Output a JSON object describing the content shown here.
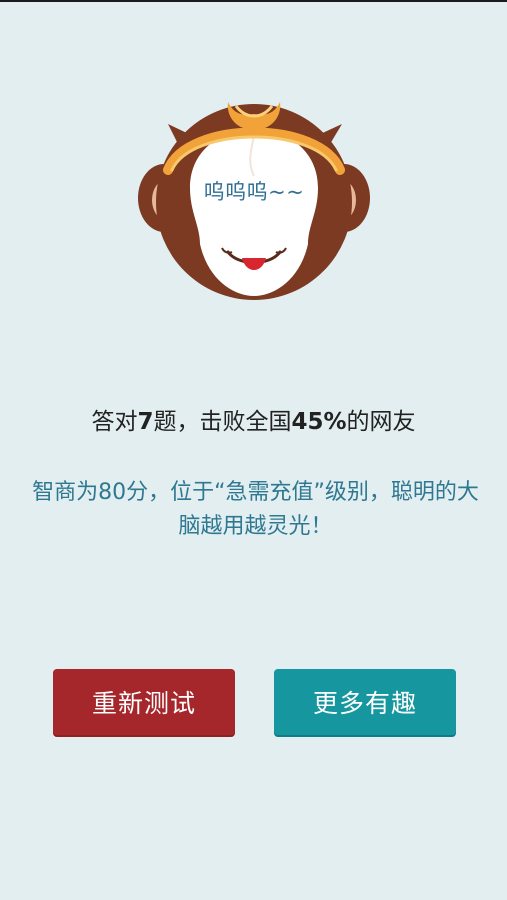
{
  "mascot": {
    "speech": "呜呜呜~~",
    "icon": "monkey-face-icon"
  },
  "result": {
    "prefix": "答对",
    "correct_count": "7",
    "middle": "题，击败全国",
    "percent": "45%",
    "suffix": "的网友"
  },
  "description": "智商为80分，位于“急需充值”级别，聪明的大脑越用越灵光！",
  "buttons": {
    "retry_label": "重新测试",
    "more_label": "更多有趣"
  },
  "colors": {
    "background": "#e2eef0",
    "retry_button": "#a5272b",
    "more_button": "#16979f",
    "description_text": "#2f7891"
  }
}
